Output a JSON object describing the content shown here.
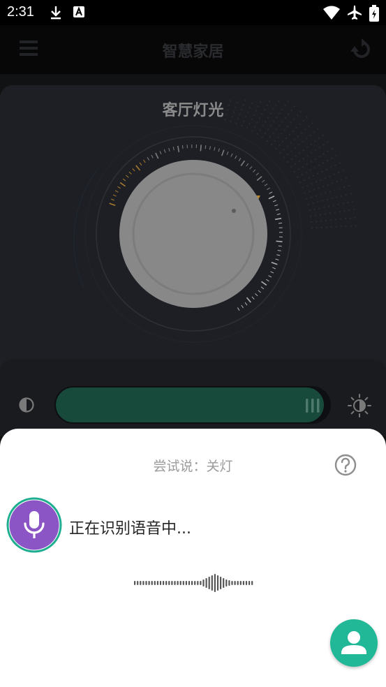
{
  "status_bar": {
    "time": "2:31",
    "icons": [
      "download-icon",
      "text-recognition-icon",
      "wifi-icon",
      "airplane-icon",
      "battery-charging-icon"
    ]
  },
  "app_bar": {
    "title": "智慧家居",
    "left_icon": "menu-icon",
    "right_icon": "refresh-icon"
  },
  "light_card": {
    "title": "客厅灯光"
  },
  "brightness": {
    "level": 0.97,
    "left_icon": "contrast-icon",
    "right_icon": "brightness-icon"
  },
  "voice_sheet": {
    "hint": "尝试说：关灯",
    "status": "正在识别语音中...",
    "help_icon": "help-circle-icon",
    "mic_icon": "microphone-icon",
    "user_icon": "user-icon"
  },
  "colors": {
    "accent_green": "#20b896",
    "mic_purple": "#8c55c6",
    "dial_orange": "#b8862e",
    "slider_fill": "#174a3b"
  }
}
